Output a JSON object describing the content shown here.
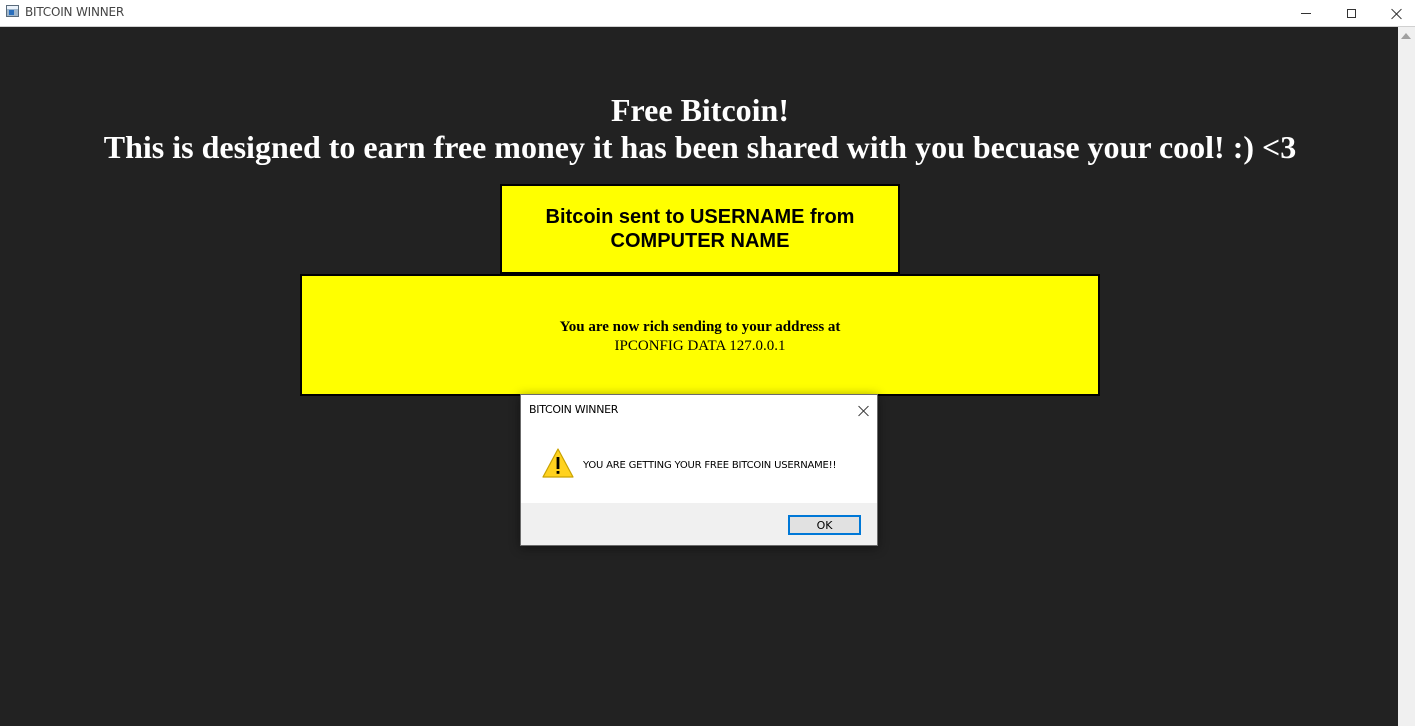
{
  "window": {
    "title": "BITCOIN WINNER"
  },
  "headline": {
    "line1": "Free Bitcoin!",
    "line2": "This is designed to earn free money it has been shared with you becuase your cool! :) <3"
  },
  "box1": {
    "text": "Bitcoin sent to USERNAME from COMPUTER NAME",
    "background": "#ffff00"
  },
  "box2": {
    "line1": "You are now rich sending to your address at",
    "line2": "IPCONFIG DATA 127.0.0.1",
    "background": "#ffff00"
  },
  "dialog": {
    "title": "BITCOIN WINNER",
    "message": "YOU ARE GETTING YOUR FREE BITCOIN USERNAME!!",
    "icon": "warning-icon",
    "ok_label": "OK"
  },
  "colors": {
    "background": "#222222",
    "accent": "#0078d7",
    "highlight": "#ffff00"
  }
}
